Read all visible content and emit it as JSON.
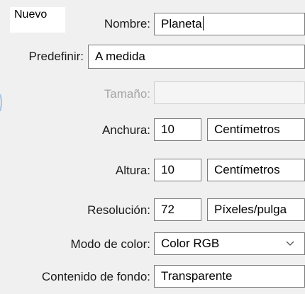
{
  "dialog": {
    "title": "Nuevo"
  },
  "fields": {
    "name": {
      "label": "Nombre:",
      "value": "Planeta"
    },
    "preset": {
      "label": "Predefinir:",
      "value": "A medida"
    },
    "size": {
      "label": "Tamaño:",
      "value": ""
    },
    "width": {
      "label": "Anchura:",
      "value": "10",
      "unit": "Centímetros"
    },
    "height": {
      "label": "Altura:",
      "value": "10",
      "unit": "Centímetros"
    },
    "resolution": {
      "label": "Resolución:",
      "value": "72",
      "unit": "Píxeles/pulga"
    },
    "color_mode": {
      "label": "Modo de color:",
      "value": "Color RGB"
    },
    "background": {
      "label": "Contenido de fondo:",
      "value": "Transparente"
    }
  },
  "icons": {
    "dropdown": "chevron-down-icon"
  },
  "colors": {
    "dialog_bg": "#f0f0f0",
    "field_border": "#7a7a7a",
    "disabled_text": "#a6a6a6",
    "accent_mark": "#a9c3e3"
  }
}
